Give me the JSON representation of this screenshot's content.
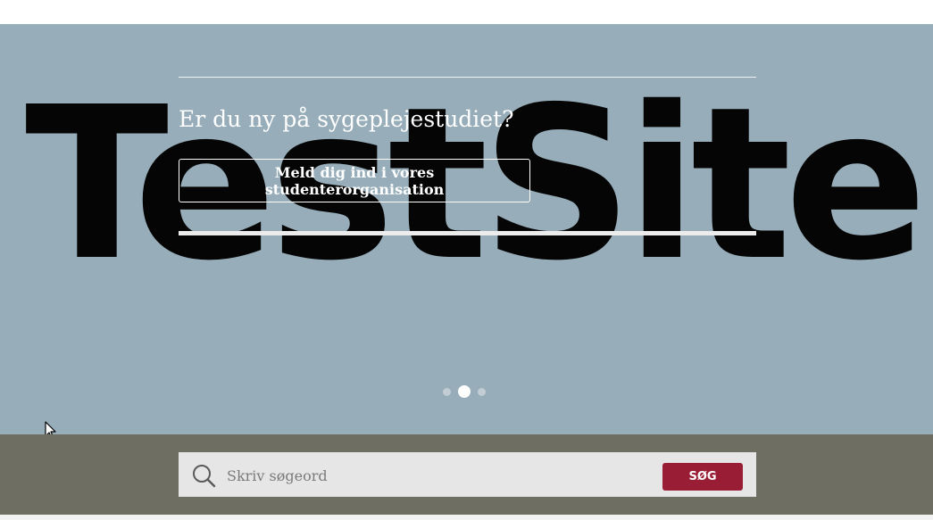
{
  "hero": {
    "logo_text": "TestSite",
    "heading": "Er du ny på sygeplejestudiet?",
    "cta_label": "Meld dig ind i vores studenterorganisation",
    "carousel": {
      "slides": 3,
      "active_index": 1
    }
  },
  "search": {
    "placeholder": "Skriv søgeord",
    "value": "",
    "button_label": "SØG"
  },
  "colors": {
    "hero_background": "#97adb9",
    "search_band": "#6f6e62",
    "accent_button": "#9a1d36"
  },
  "icons": [
    "search-icon",
    "mouse-cursor-icon"
  ]
}
